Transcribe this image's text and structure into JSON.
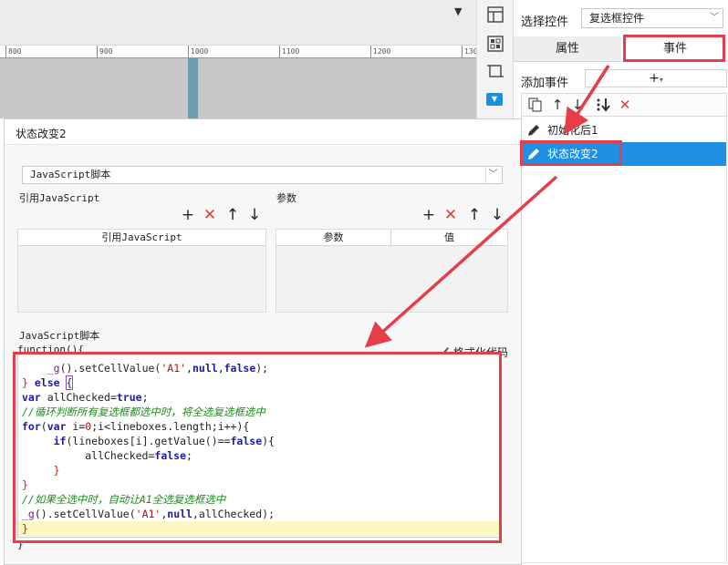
{
  "designer": {
    "ruler_labels": [
      "800",
      "900",
      "1000",
      "1100",
      "1200",
      "130"
    ]
  },
  "icons": {
    "strip": [
      "layout-icon",
      "form-icon",
      "crop-icon",
      "dropdown-icon"
    ],
    "collapse": "collapse-icon"
  },
  "right_panel": {
    "select_control_label": "选择控件",
    "select_control_value": "复选框控件",
    "tab_properties": "属性",
    "tab_events": "事件",
    "add_event_label": "添加事件",
    "add_event_button": "+",
    "events": [
      {
        "label": "初始化后1",
        "selected": false
      },
      {
        "label": "状态改变2",
        "selected": true
      }
    ]
  },
  "dialog": {
    "title": "状态改变2",
    "script_type": "JavaScript脚本",
    "ref_js_label": "引用JavaScript",
    "params_label": "参数",
    "ref_js_column": "引用JavaScript",
    "params_columns": [
      "参数",
      "值"
    ],
    "script_section_label": "JavaScript脚本",
    "format_code_label": "格式化代码",
    "function_open": "function(){",
    "function_close": "}"
  },
  "code": {
    "lines": [
      "    _g().setCellValue('A1',null,false);",
      "} else {",
      "var allChecked=true;",
      "//循环判断所有复选框都选中时，将全选复选框选中",
      "for(var i=0;i<lineboxes.length;i++){",
      "    if(lineboxes[i].getValue()==false){",
      "        allChecked=false;",
      "    }",
      "}",
      "//如果全选中时，自动让A1全选复选框选中",
      "_g().setCellValue('A1',null,allChecked);",
      "}"
    ]
  },
  "colors": {
    "accent": "#1e8fe2",
    "annotation": "#e53e48",
    "delete": "#e53935"
  }
}
